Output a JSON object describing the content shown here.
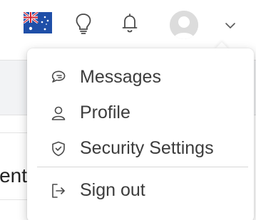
{
  "header": {
    "flag_icon": "australia-flag-icon",
    "icons": [
      "lightbulb-icon",
      "bell-icon",
      "avatar-icon",
      "chevron-down-icon"
    ]
  },
  "background": {
    "partial_text": "ent"
  },
  "menu": {
    "items": [
      {
        "label": "Messages",
        "icon": "chat-bubble-icon"
      },
      {
        "label": "Profile",
        "icon": "person-icon"
      },
      {
        "label": "Security Settings",
        "icon": "shield-check-icon"
      },
      {
        "label": "Sign out",
        "icon": "sign-out-icon"
      }
    ]
  },
  "colors": {
    "text": "#3c3c3c",
    "icon_stroke": "#4a4a4a",
    "flag_blue": "#1f4fa8",
    "flag_red": "#d0202e"
  }
}
